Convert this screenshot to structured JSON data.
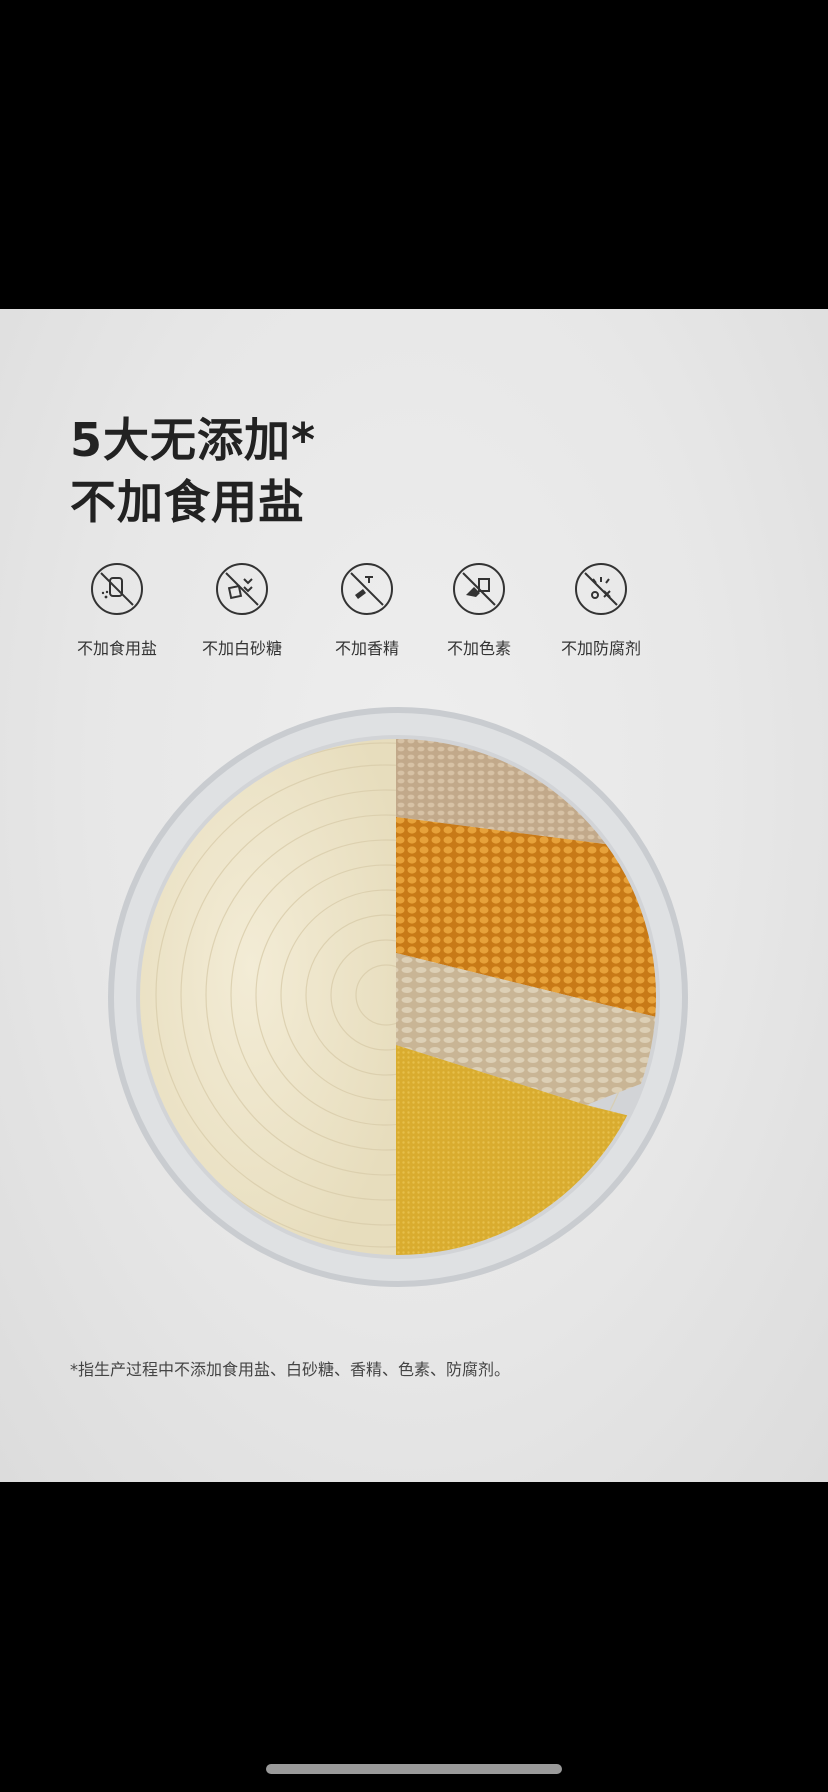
{
  "heading": {
    "line1": "5大无添加*",
    "line2": "不加食用盐"
  },
  "icons": [
    {
      "label": "不加食用盐",
      "icon": "salt-shaker-icon"
    },
    {
      "label": "不加白砂糖",
      "icon": "sugar-icon"
    },
    {
      "label": "不加香精",
      "icon": "flavor-dropper-icon"
    },
    {
      "label": "不加色素",
      "icon": "pigment-icon"
    },
    {
      "label": "不加防腐剂",
      "icon": "preservative-icon"
    }
  ],
  "footnote": "*指生产过程中不添加食用盐、白砂糖、香精、色素、防腐剂。"
}
